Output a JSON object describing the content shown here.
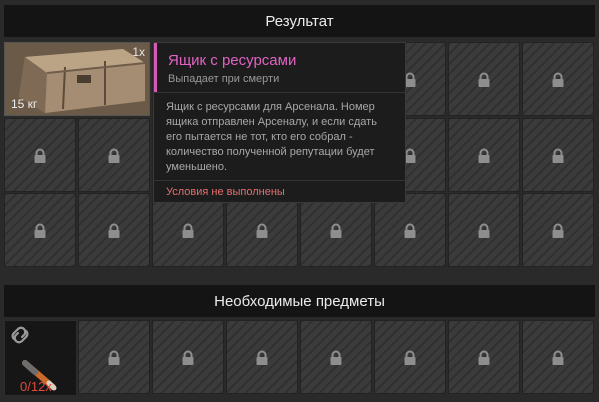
{
  "result_panel": {
    "title": "Результат",
    "item": {
      "count": "1x",
      "weight": "15 кг",
      "icon": "crate-icon"
    }
  },
  "tooltip": {
    "title": "Ящик с ресурсами",
    "subtitle": "Выпадает при смерти",
    "description": "Ящик с ресурсами для Арсенала. Номер ящика отправлен Арсеналу, и если сдать его пытается не тот, кто его собрал - количество полученной репутации будет уменьшено.",
    "condition": "Условия не выполнены",
    "accent_color": "#e063c4",
    "condition_color": "#e36f6f"
  },
  "required_panel": {
    "title": "Необходимые предметы",
    "item": {
      "count": "0/12x",
      "icon": "link-icon"
    }
  },
  "colors": {
    "cell_bg": "#3b3b3b",
    "header_bg": "#141414",
    "error": "#e14a3a"
  }
}
